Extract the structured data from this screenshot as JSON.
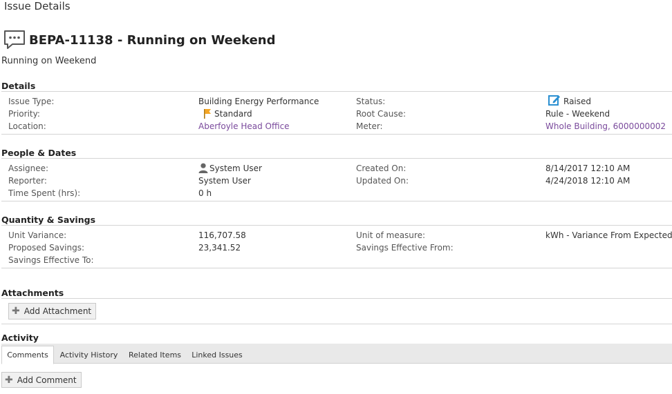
{
  "page": {
    "heading": "Issue Details"
  },
  "issue": {
    "title": "BEPA-11138 - Running on Weekend",
    "description": "Running on Weekend"
  },
  "details": {
    "section_title": "Details",
    "issue_type_label": "Issue Type:",
    "issue_type_value": "Building Energy Performance",
    "priority_label": "Priority:",
    "priority_value": "Standard",
    "location_label": "Location:",
    "location_value": "Aberfoyle Head Office",
    "status_label": "Status:",
    "status_value": "Raised",
    "root_cause_label": "Root Cause:",
    "root_cause_value": "Rule - Weekend",
    "meter_label": "Meter:",
    "meter_value": "Whole Building, 6000000002"
  },
  "people": {
    "section_title": "People & Dates",
    "assignee_label": "Assignee:",
    "assignee_value": "System User",
    "reporter_label": "Reporter:",
    "reporter_value": "System User",
    "time_spent_label": "Time Spent (hrs):",
    "time_spent_value": "0 h",
    "created_label": "Created On:",
    "created_value": "8/14/2017 12:10 AM",
    "updated_label": "Updated On:",
    "updated_value": "4/24/2018 12:10 AM"
  },
  "quantity": {
    "section_title": "Quantity & Savings",
    "unit_variance_label": "Unit Variance:",
    "unit_variance_value": "116,707.58",
    "proposed_savings_label": "Proposed Savings:",
    "proposed_savings_value": "23,341.52",
    "savings_to_label": "Savings Effective To:",
    "unit_measure_label": "Unit of measure:",
    "unit_measure_value": "kWh - Variance From Expected",
    "savings_from_label": "Savings Effective From:"
  },
  "attachments": {
    "section_title": "Attachments",
    "add_label": "Add Attachment"
  },
  "activity": {
    "section_title": "Activity",
    "tabs": [
      {
        "label": "Comments",
        "active": true
      },
      {
        "label": "Activity History",
        "active": false
      },
      {
        "label": "Related Items",
        "active": false
      },
      {
        "label": "Linked Issues",
        "active": false
      }
    ],
    "add_comment_label": "Add Comment"
  },
  "colors": {
    "link": "#7a4a9c",
    "flag": "#f5a623",
    "status_icon": "#2a8fd1",
    "tab_bar": "#e9e9e9"
  },
  "icons": {
    "title": "comment-bubble-icon",
    "priority": "flag-icon",
    "status": "edit-note-icon",
    "assignee": "user-icon",
    "add": "plus-icon"
  }
}
